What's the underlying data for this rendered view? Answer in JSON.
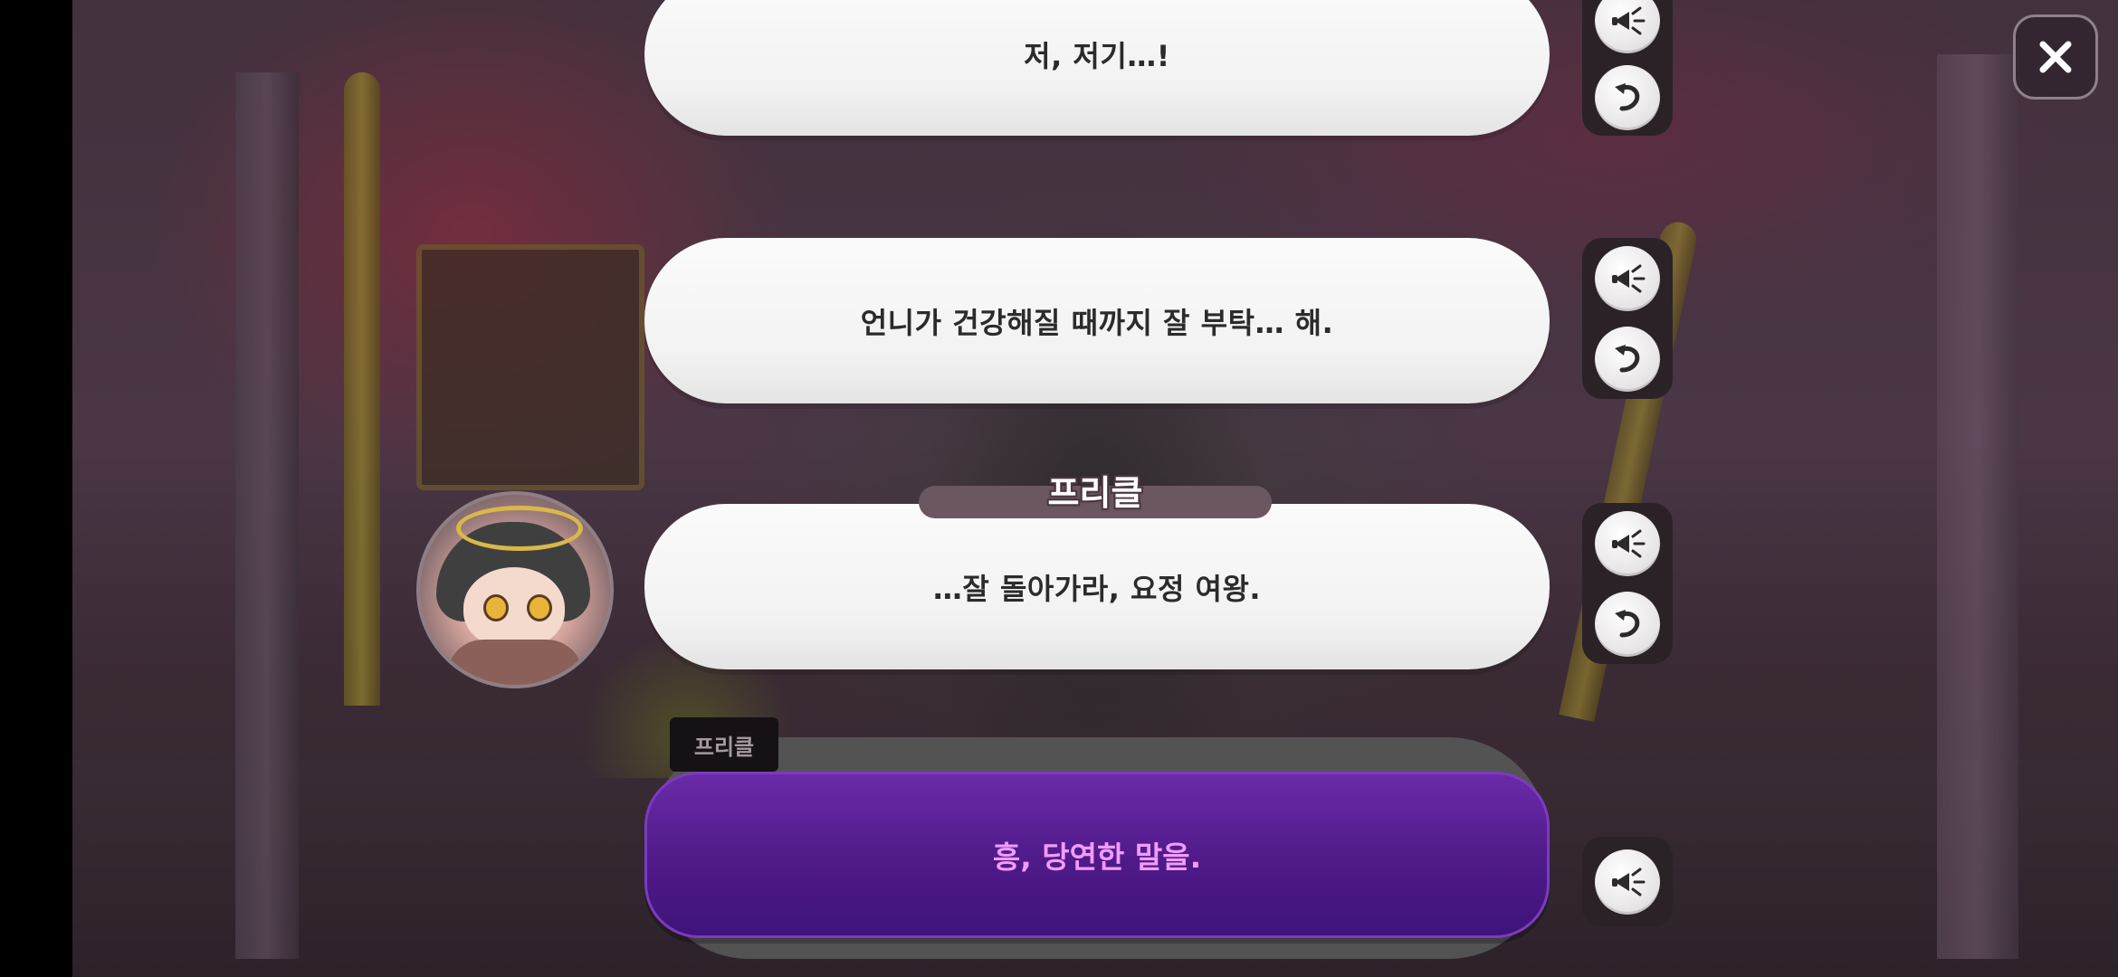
{
  "dialogue": {
    "lines": [
      {
        "text": "저, 저기…!"
      },
      {
        "text": "언니가 건강해질 때까지 잘 부탁… 해."
      },
      {
        "text": "…잘 돌아가라, 요정 여왕.",
        "speaker": "프리클"
      }
    ],
    "current_choice": {
      "speaker": "프리클",
      "text": "흥, 당연한 말을."
    }
  },
  "icons": {
    "voice": "megaphone-icon",
    "replay": "replay-arrow-icon",
    "close": "close-icon"
  },
  "colors": {
    "choice_bg": "#4f1a88",
    "choice_text": "#f19cff",
    "bubble_bg": "#f6f6f6",
    "name_tab": "#6b5761"
  }
}
